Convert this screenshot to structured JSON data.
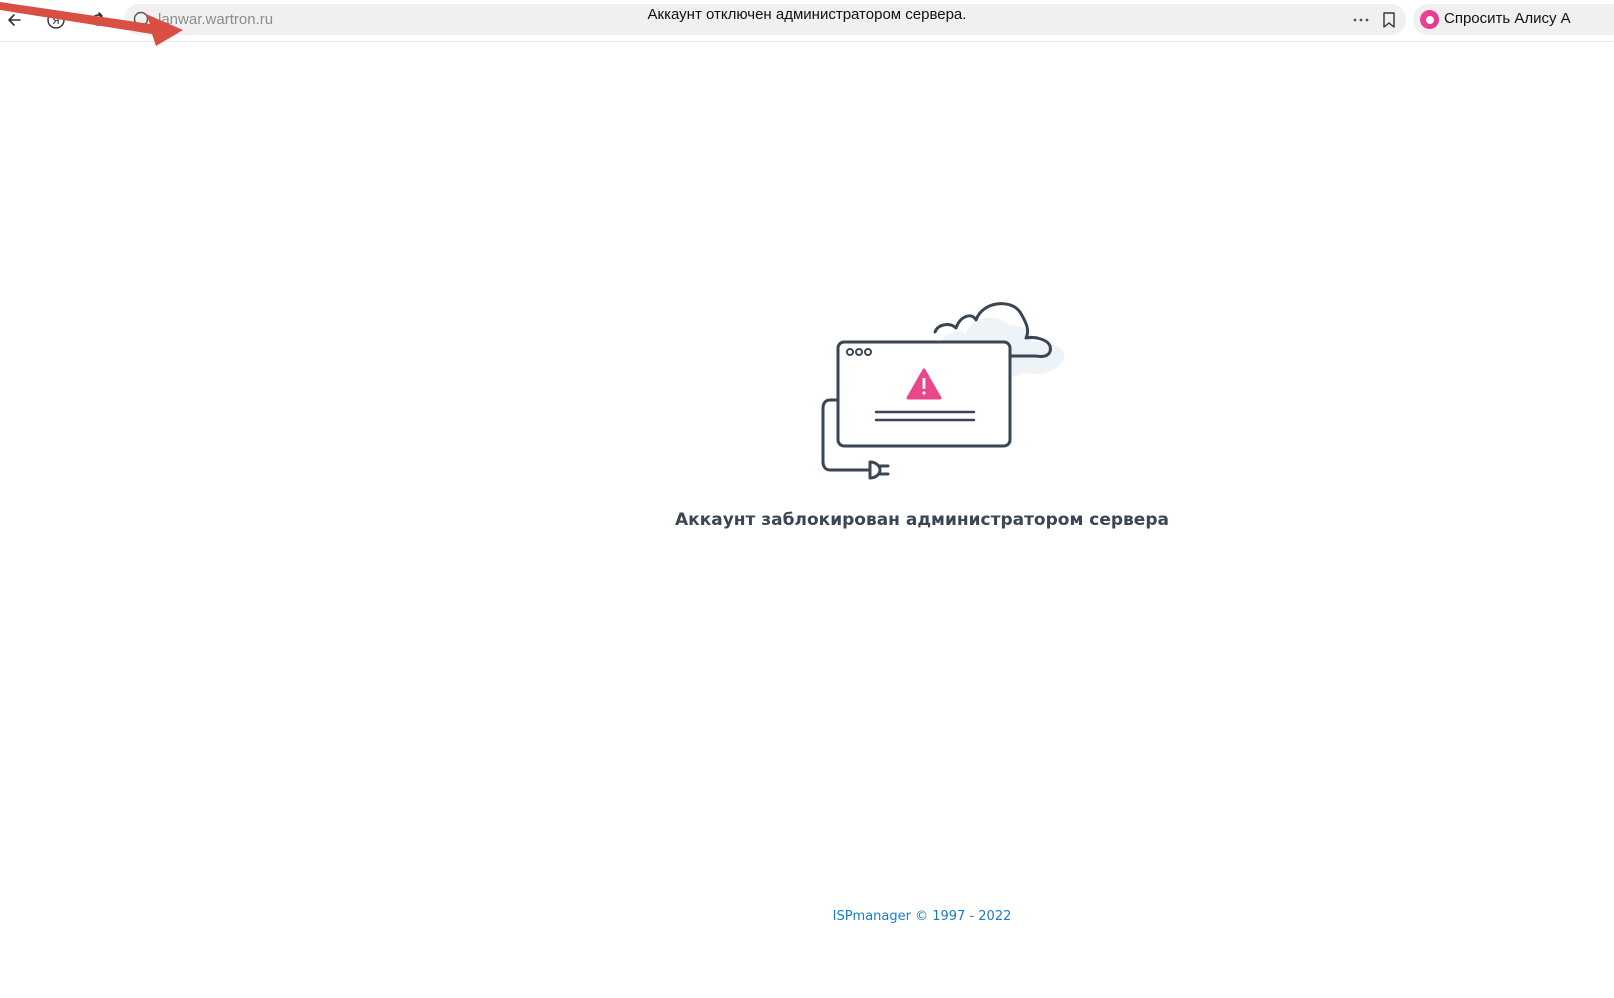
{
  "browser": {
    "url": "lanwar.wartron.ru",
    "tab_title": "Аккаунт отключен администратором сервера.",
    "alice_label": "Спросить Алису А",
    "icons": {
      "back": "back-arrow-icon",
      "yandex": "yandex-icon",
      "reload": "reload-icon",
      "site_info": "site-info-icon",
      "more": "more-dots-icon",
      "bookmark": "bookmark-icon",
      "alice": "alice-icon"
    }
  },
  "annotation": {
    "arrow_color": "#d94f43"
  },
  "page": {
    "message": "Аккаунт заблокирован администратором сервера",
    "footer": "ISPmanager © 1997 - 2022",
    "colors": {
      "message": "#3a4654",
      "footer_link": "#1a7cc3",
      "warning": "#e8478c"
    }
  }
}
